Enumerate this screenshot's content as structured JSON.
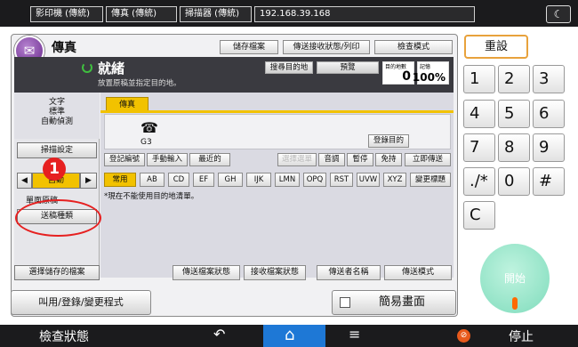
{
  "topbar": {
    "tabs": [
      "影印機 (傳統)",
      "傳真 (傳統)",
      "掃描器 (傳統)"
    ],
    "address": "192.168.39.168",
    "night_icon": "moon-icon"
  },
  "app": {
    "title": "傳真",
    "header_buttons": [
      "儲存檔案",
      "傳送接收狀態/列印",
      "檢查模式"
    ]
  },
  "status": {
    "text": "就緒",
    "sub": "放置原稿並指定目的地。",
    "dest_list_btn": "搜尋目的地",
    "preview_btn": "預覽",
    "dest_count_label": "目的地數",
    "dest_count": "0",
    "memory_label": "記憶",
    "memory": "100%"
  },
  "left": {
    "settings_label": "文字\n標準\n自動偵測",
    "scan_settings_btn": "掃描設定",
    "density_label": "自動",
    "single_original": "單面原稿",
    "original_type": "送稿種類",
    "select_saved": "選擇儲存的檔案"
  },
  "dest": {
    "tab": "傳真",
    "fax_label": "G3",
    "register_dest": "登錄目的",
    "row_buttons": [
      "登記編號",
      "手動輸入",
      "最近的"
    ],
    "row_buttons2": [
      "選擇選單",
      "音調",
      "暫停",
      "免持",
      "立即傳送"
    ],
    "alpha_buttons": [
      "常用",
      "AB",
      "CD",
      "EF",
      "GH",
      "IJK",
      "LMN",
      "OPQ",
      "RST",
      "UVW",
      "XYZ",
      "變更標題"
    ],
    "note": "*現在不能使用目的地清單。"
  },
  "bottom": {
    "buttons": [
      "傳送檔案狀態",
      "接收檔案狀態",
      "傳送者名稱",
      "傳送模式"
    ],
    "program_btn": "叫用/登錄/變更程式",
    "simple_screen": "簡易畫面"
  },
  "keypad": {
    "reset": "重設",
    "keys": [
      "1",
      "2",
      "3",
      "4",
      "5",
      "6",
      "7",
      "8",
      "9",
      "./*",
      "0",
      "#",
      "C"
    ],
    "start": "開始"
  },
  "nav": {
    "check_status": "檢查狀態",
    "stop": "停止"
  },
  "annotation": {
    "marker_number": "1"
  },
  "colors": {
    "accent_yellow": "#f2c200",
    "status_green": "#3fbf3f",
    "start_green": "#7fdcbc",
    "home_blue": "#1e78d6",
    "marker_red": "#e62020"
  }
}
